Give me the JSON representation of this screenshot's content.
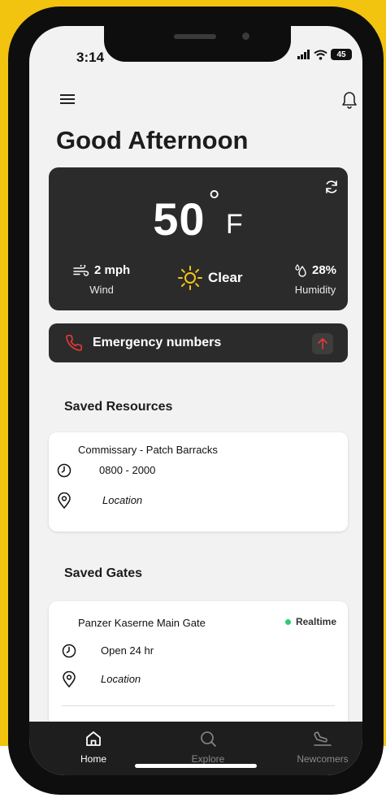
{
  "status_bar": {
    "time": "3:14",
    "battery": "45"
  },
  "header": {
    "greeting": "Good Afternoon"
  },
  "weather": {
    "temperature": "50",
    "degree_symbol": "°",
    "unit": "F",
    "wind_value": "2 mph",
    "wind_label": "Wind",
    "condition": "Clear",
    "humidity_value": "28%",
    "humidity_label": "Humidity"
  },
  "emergency": {
    "label": "Emergency numbers"
  },
  "saved_resources": {
    "title": "Saved Resources",
    "items": [
      {
        "name": "Commissary - Patch Barracks",
        "hours": "0800 - 2000",
        "location": "Location"
      }
    ]
  },
  "saved_gates": {
    "title": "Saved Gates",
    "items": [
      {
        "name": "Panzer Kaserne Main Gate",
        "status": "Realtime",
        "hours": "Open 24 hr",
        "location": "Location"
      }
    ]
  },
  "tabs": [
    {
      "label": "Home",
      "icon": "home-icon",
      "active": true
    },
    {
      "label": "Explore",
      "icon": "search-icon",
      "active": false
    },
    {
      "label": "Newcomers",
      "icon": "plane-landing-icon",
      "active": false
    }
  ],
  "colors": {
    "brand_yellow": "#f2c30f",
    "card_dark": "#2b2b2b",
    "emergency_red": "#e53935",
    "realtime_green": "#2ecc71",
    "sun_yellow": "#f5c518"
  }
}
